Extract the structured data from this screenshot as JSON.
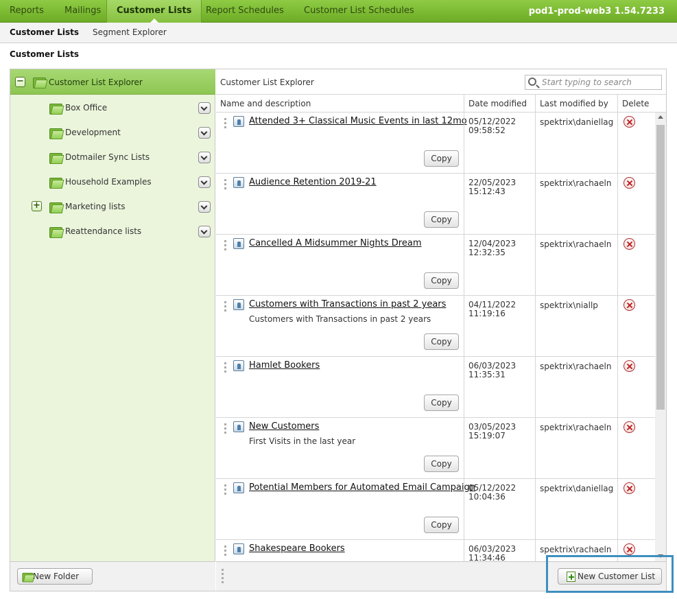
{
  "topnav": {
    "tabs": [
      {
        "label": "Reports"
      },
      {
        "label": "Mailings"
      },
      {
        "label": "Customer Lists"
      },
      {
        "label": "Report Schedules"
      },
      {
        "label": "Customer List Schedules"
      }
    ],
    "server": "pod1-prod-web3 1.54.7233"
  },
  "subnav": {
    "items": [
      {
        "label": "Customer Lists"
      },
      {
        "label": "Segment Explorer"
      }
    ]
  },
  "page_title": "Customer Lists",
  "tree": {
    "root_label": "Customer List Explorer",
    "folders": [
      {
        "label": "Box Office"
      },
      {
        "label": "Development"
      },
      {
        "label": "Dotmailer Sync Lists"
      },
      {
        "label": "Household Examples"
      },
      {
        "label": "Marketing lists"
      },
      {
        "label": "Reattendance lists"
      }
    ],
    "new_folder_label": "New Folder"
  },
  "explorer": {
    "title": "Customer List Explorer",
    "search_placeholder": "Start typing to search",
    "columns": [
      "Name and description",
      "Date modified",
      "Last modified by",
      "Delete"
    ],
    "copy_label": "Copy",
    "rows": [
      {
        "name": "Attended 3+ Classical Music Events in last 12mo",
        "desc": "",
        "date": "05/12/2022",
        "time": "09:58:52",
        "by": "spektrix\\daniellag"
      },
      {
        "name": "Audience Retention 2019-21",
        "desc": "",
        "date": "22/05/2023",
        "time": "15:12:43",
        "by": "spektrix\\rachaeln"
      },
      {
        "name": "Cancelled A Midsummer Nights Dream",
        "desc": "",
        "date": "12/04/2023",
        "time": "12:32:35",
        "by": "spektrix\\rachaeln"
      },
      {
        "name": "Customers with Transactions in past 2 years",
        "desc": "Customers with Transactions in past 2 years",
        "date": "04/11/2022",
        "time": "11:19:16",
        "by": "spektrix\\niallp"
      },
      {
        "name": "Hamlet Bookers",
        "desc": "",
        "date": "06/03/2023",
        "time": "11:35:31",
        "by": "spektrix\\rachaeln"
      },
      {
        "name": "New Customers",
        "desc": "First Visits in the last year",
        "date": "03/05/2023",
        "time": "15:19:07",
        "by": "spektrix\\rachaeln"
      },
      {
        "name": "Potential Members for Automated Email Campaign",
        "desc": "",
        "date": "05/12/2022",
        "time": "10:04:36",
        "by": "spektrix\\daniellag"
      },
      {
        "name": "Shakespeare Bookers",
        "desc": "",
        "date": "06/03/2023",
        "time": "11:34:46",
        "by": "spektrix\\rachaeln"
      }
    ],
    "new_list_label": "New Customer List"
  }
}
